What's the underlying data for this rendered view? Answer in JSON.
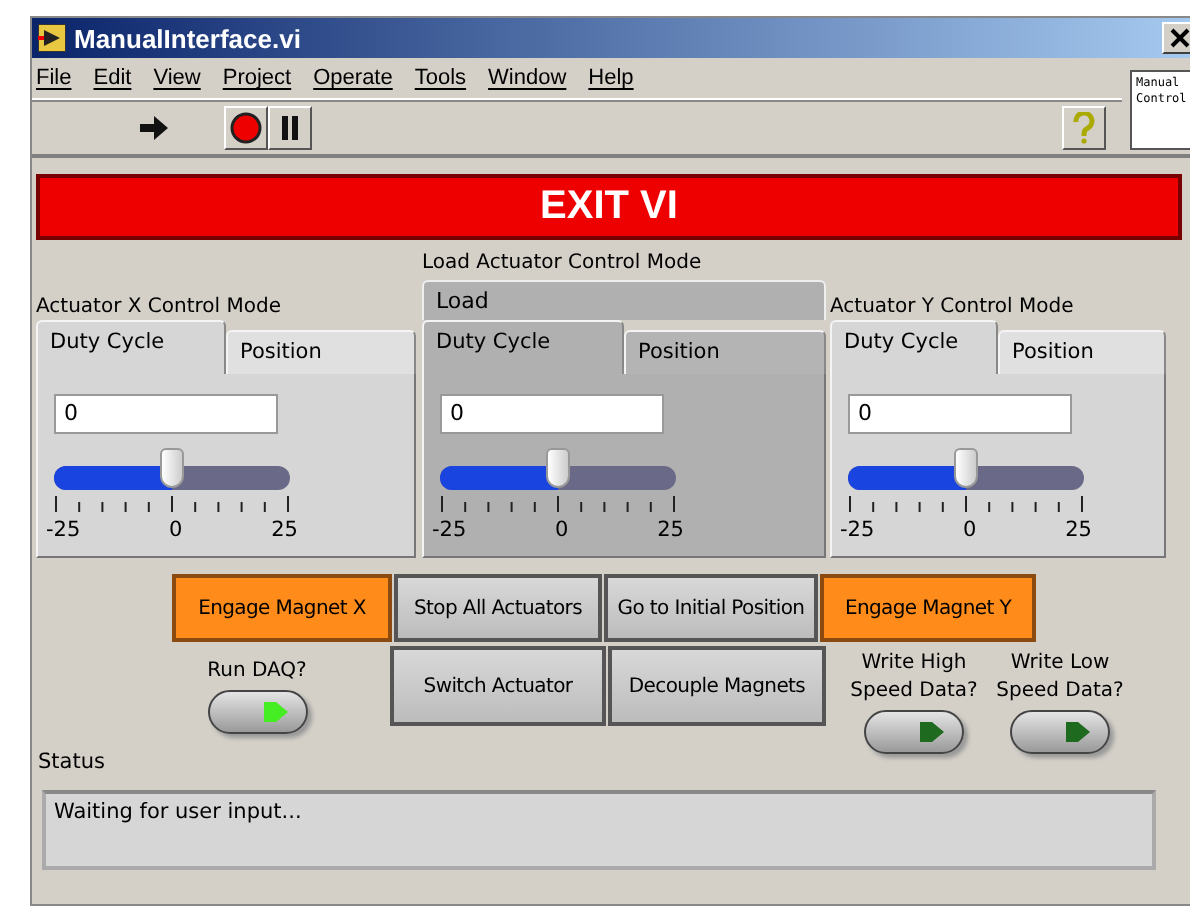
{
  "window": {
    "title": "ManualInterface.vi"
  },
  "menu": [
    "File",
    "Edit",
    "View",
    "Project",
    "Operate",
    "Tools",
    "Window",
    "Help"
  ],
  "context_help": {
    "text": "Manual Control"
  },
  "exit_button": {
    "label": "EXIT VI"
  },
  "tab_controls": [
    {
      "label": "Actuator X Control Mode",
      "disabled": false,
      "tabs": [
        {
          "label": "Duty Cycle",
          "selected": true
        },
        {
          "label": "Position",
          "selected": false
        }
      ],
      "value": "0",
      "slider": {
        "level": 0.5,
        "ticks": [
          "-25",
          "0",
          "25"
        ]
      }
    },
    {
      "label": "Load Actuator Control Mode",
      "disabled": true,
      "outer_tab": {
        "label": "Load",
        "selected": true
      },
      "tabs": [
        {
          "label": "Duty Cycle",
          "selected": true
        },
        {
          "label": "Position",
          "selected": false
        }
      ],
      "value": "0",
      "slider": {
        "level": 0.5,
        "ticks": [
          "-25",
          "0",
          "25"
        ]
      }
    },
    {
      "label": "Actuator Y Control Mode",
      "disabled": false,
      "tabs": [
        {
          "label": "Duty Cycle",
          "selected": true
        },
        {
          "label": "Position",
          "selected": false
        }
      ],
      "value": "0",
      "slider": {
        "level": 0.5,
        "ticks": [
          "-25",
          "0",
          "25"
        ]
      }
    }
  ],
  "buttons": [
    {
      "label": "Engage Magnet X",
      "kind": "highlighted"
    },
    {
      "label": "Stop All Actuators",
      "kind": "normal"
    },
    {
      "label": "Go to Initial Position",
      "kind": "normal"
    },
    {
      "label": "Engage Magnet Y",
      "kind": "highlighted"
    },
    {
      "label": "Switch Actuator",
      "kind": "normal"
    },
    {
      "label": "Decouple Magnets",
      "kind": "normal"
    }
  ],
  "leds": [
    {
      "label": "Run DAQ?",
      "on": true
    },
    {
      "label": "Write High Speed Data?",
      "on": false
    },
    {
      "label": "Write Low Speed Data?",
      "on": false
    }
  ],
  "status": {
    "label": "Status",
    "text": "Waiting for user input..."
  }
}
